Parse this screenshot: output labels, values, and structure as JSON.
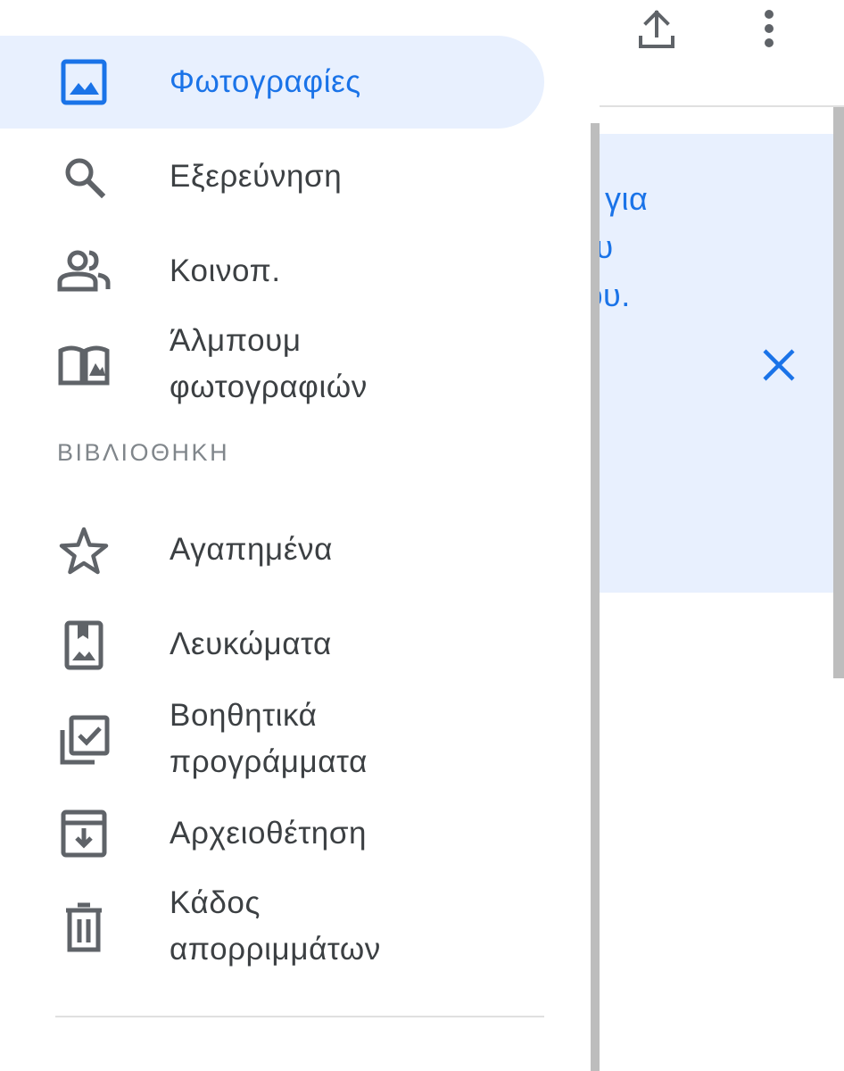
{
  "background": {
    "banner_lines": [
      "η για",
      "ου",
      "ίου."
    ],
    "icons": {
      "upload": "upload-icon",
      "more": "more-vert-icon",
      "close": "close-icon"
    }
  },
  "drawer": {
    "items": [
      {
        "label": "Φωτογραφίες",
        "icon": "photo-icon",
        "active": true
      },
      {
        "label": "Εξερεύνηση",
        "icon": "search-icon"
      },
      {
        "label": "Κοινοπ.",
        "icon": "people-icon"
      },
      {
        "label_line1": "Άλμπουμ",
        "label_line2": "φωτογραφιών",
        "icon": "photo-book-icon"
      }
    ],
    "section_header": "ΒΙΒΛΙΟΘΗΚΗ",
    "library_items": [
      {
        "label": "Αγαπημένα",
        "icon": "star-icon"
      },
      {
        "label": "Λευκώματα",
        "icon": "album-icon"
      },
      {
        "label_line1": "Βοηθητικά",
        "label_line2": "προγράμματα",
        "icon": "utilities-icon"
      },
      {
        "label": "Αρχειοθέτηση",
        "icon": "archive-icon"
      },
      {
        "label_line1": "Κάδος",
        "label_line2": "απορριμμάτων",
        "icon": "trash-icon"
      }
    ]
  },
  "colors": {
    "accent": "#1a73e8",
    "active_bg": "#e8f0fe",
    "text": "#3c4043",
    "muted": "#80868b"
  }
}
